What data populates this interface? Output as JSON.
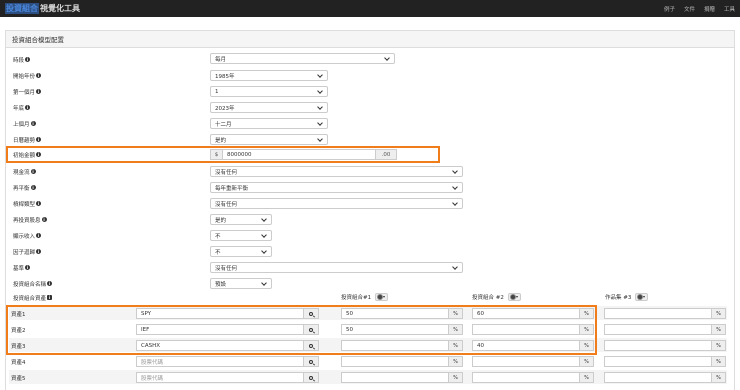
{
  "app": {
    "brand_highlight": "投資組合",
    "brand_rest": "視覺化工具"
  },
  "nav": {
    "items": [
      "例子",
      "文件",
      "捐贈",
      "工具"
    ]
  },
  "panel": {
    "title": "投資組合模型配置"
  },
  "form": {
    "time_period": {
      "label": "時段",
      "value": "每月"
    },
    "start_year": {
      "label": "開始年份",
      "value": "1985年"
    },
    "first_month": {
      "label": "第一個月",
      "value": "1"
    },
    "end_year": {
      "label": "年底",
      "value": "2023年"
    },
    "last_month": {
      "label": "上個月",
      "value": "十二月"
    },
    "include_ytd": {
      "label": "日曆趨勢",
      "value": "是的"
    },
    "initial_amount": {
      "label": "初始金額",
      "currency": "$",
      "value": "8000000",
      "suffix": ".00"
    },
    "cashflows": {
      "label": "現金流",
      "value": "沒有任何"
    },
    "rebalancing": {
      "label": "再平衡",
      "value": "每年重新平衡"
    },
    "leverage": {
      "label": "槓桿類型",
      "value": "沒有任何"
    },
    "reinvest_dividends": {
      "label": "再投資股息",
      "value": "是的"
    },
    "display_income": {
      "label": "顯示收入",
      "value": "不"
    },
    "factor_regression": {
      "label": "因子迴歸",
      "value": "不"
    },
    "benchmark": {
      "label": "基準",
      "value": "沒有任何"
    },
    "portfolio_names": {
      "label": "投資組合名稱",
      "value": "預設"
    },
    "assets_label": "投資組合資產"
  },
  "portfolios": {
    "p1": {
      "label": "投資組合#1"
    },
    "p2": {
      "label": "投資組合 #2"
    },
    "p3": {
      "label": "作品集 #3"
    }
  },
  "assets": [
    {
      "label": "資產1",
      "ticker": "SPY",
      "p1": "50",
      "p2": "60",
      "p3": ""
    },
    {
      "label": "資產2",
      "ticker": "IEF",
      "p1": "50",
      "p2": "",
      "p3": ""
    },
    {
      "label": "資產3",
      "ticker": "CASHX",
      "p1": "",
      "p2": "40",
      "p3": ""
    },
    {
      "label": "資產4",
      "ticker": "",
      "p1": "",
      "p2": "",
      "p3": ""
    },
    {
      "label": "資產5",
      "ticker": "",
      "p1": "",
      "p2": "",
      "p3": ""
    }
  ],
  "ticker_placeholder": "股票代碼",
  "percent_suffix": "%",
  "colors": {
    "highlight_border": "#f07d1a",
    "navbar_bg": "#222222",
    "brand_accent": "#4a86d9"
  }
}
